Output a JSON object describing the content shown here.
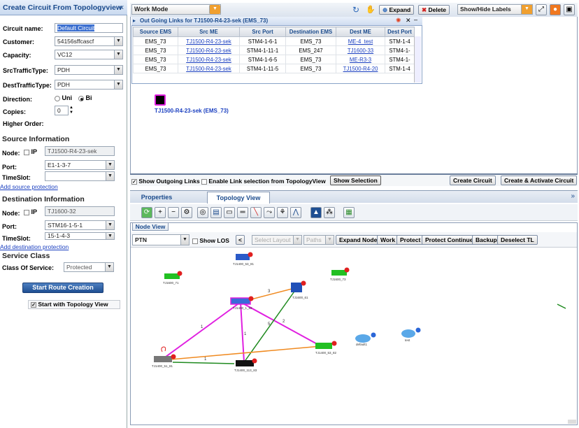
{
  "left_panel": {
    "title": "Create Circuit From Topologyview",
    "collapse_icon": "«",
    "circuit_name": {
      "label": "Circuit name:",
      "value": "Default Circuit"
    },
    "customer": {
      "label": "Customer:",
      "value": "54156sffcascf"
    },
    "capacity": {
      "label": "Capacity:",
      "value": "VC12"
    },
    "src_traffic_type": {
      "label": "SrcTrafficType:",
      "value": "PDH"
    },
    "dest_traffic_type": {
      "label": "DestTrafficType:",
      "value": "PDH"
    },
    "direction": {
      "label": "Direction:",
      "uni": "Uni",
      "bi": "Bi",
      "selected": "Bi"
    },
    "copies": {
      "label": "Copies:",
      "value": "0"
    },
    "higher_order": {
      "label": "Higher Order:"
    },
    "source": {
      "title": "Source Information",
      "node_label": "Node:",
      "ip_label": "IP",
      "node_value": "TJ1500-R4-23-sek",
      "port_label": "Port:",
      "port_value": "E1-1-3-7",
      "timeslot_label": "TimeSlot:",
      "timeslot_value": "",
      "add_protection": "Add source protection"
    },
    "destination": {
      "title": "Destination Information",
      "node_label": "Node:",
      "ip_label": "IP",
      "node_value": "TJ1600-32",
      "port_label": "Port:",
      "port_value": "STM16-1-5-1",
      "timeslot_label": "TimeSlot:",
      "timeslot_value": "15-1-4-3",
      "add_protection": "Add destination protection"
    },
    "service_class": {
      "title": "Service Class",
      "cos_label": "Class Of Service:",
      "cos_value": "Protected"
    },
    "start_button": "Start Route Creation",
    "start_with_topology": "Start with Topology View"
  },
  "top_toolbar": {
    "mode": "Work Mode",
    "expand": "Expand",
    "delete": "Delete",
    "show_hide": "Show/Hide Labels"
  },
  "outgoing": {
    "title": "Out Going Links for TJ1500-R4-23-sek (EMS_73)",
    "columns": [
      "Source EMS",
      "Src ME",
      "Src Port",
      "Destination EMS",
      "Dest ME",
      "Dest Port"
    ],
    "rows": [
      [
        "EMS_73",
        "TJ1500-R4-23-sek",
        "STM4-1-6-1",
        "EMS_73",
        "ME-4_test",
        "STM-1-4"
      ],
      [
        "EMS_73",
        "TJ1500-R4-23-sek",
        "STM4-1-11-1",
        "EMS_247",
        "TJ1600-33",
        "STM4-1-"
      ],
      [
        "EMS_73",
        "TJ1500-R4-23-sek",
        "STM4-1-6-5",
        "EMS_73",
        "ME-R3-3",
        "STM4-1-"
      ],
      [
        "EMS_73",
        "TJ1500-R4-23-sek",
        "STM4-1-11-5",
        "EMS_73",
        "TJ1500-R4-20",
        "STM-1-4"
      ]
    ]
  },
  "selected_node_label": "TJ1500-R4-23-sek (EMS_73)",
  "show_bar": {
    "show_outgoing": "Show Outgoing Links",
    "enable_link_selection": "Enable Link selection from TopologyView",
    "show_selection": "Show Selection",
    "create_circuit": "Create Circuit",
    "create_activate": "Create & Activate Circuit"
  },
  "tabs": [
    "Properties",
    "Topology View"
  ],
  "node_view": {
    "tab": "Node View",
    "layer": "PTN",
    "show_los": "Show LOS",
    "back": "<",
    "select_layout": "Select Layout",
    "paths": "Paths",
    "buttons": [
      "Expand Node",
      "Work",
      "Protect",
      "Protect Continue",
      "Backup",
      "Deselect TL"
    ]
  },
  "topology": {
    "nodes": [
      "TJ1400_53_81",
      "TJ1600_71",
      "TJ1600_73",
      "TJ1400_1_92",
      "TJ1600_61",
      "TJ1400_51_81",
      "TJ1400_113_83",
      "TJ1400_53_82",
      "default1",
      "test"
    ],
    "link_labels": [
      "3",
      "1",
      "1",
      "2",
      "1",
      "5"
    ],
    "colors": {
      "magenta": "#e020e0",
      "orange": "#f08a20",
      "green": "#1f8a1f"
    }
  }
}
